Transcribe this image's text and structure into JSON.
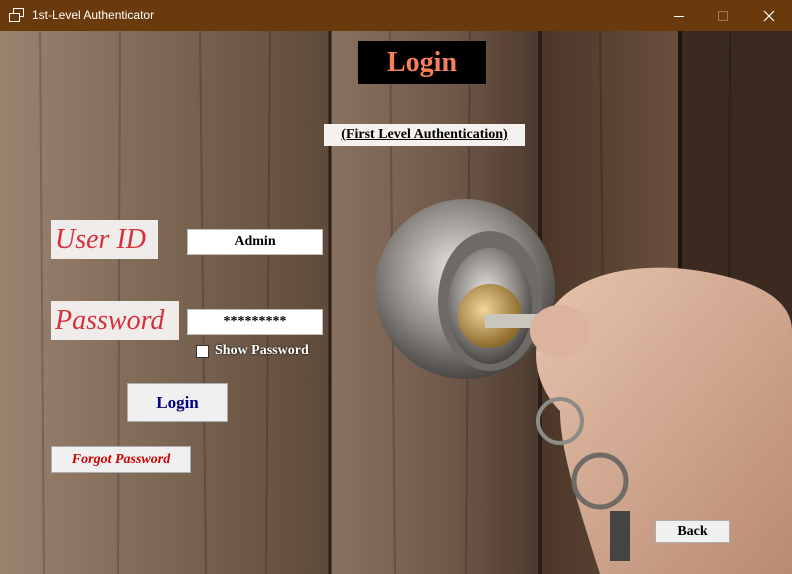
{
  "window": {
    "title": "1st-Level Authenticator",
    "controls": {
      "minimize": "—",
      "maximize": "☐",
      "close": "✕"
    }
  },
  "form": {
    "heading": "Login",
    "subheading": "(First Level Authentication)",
    "user_id_label": "User ID",
    "user_id_value": "Admin",
    "password_label": "Password",
    "password_value": "*********",
    "show_password_label": "Show Password",
    "show_password_checked": false,
    "login_button": "Login",
    "forgot_password_button": "Forgot Password",
    "back_button": "Back"
  },
  "colors": {
    "titlebar": "#6b3a0c",
    "heading_text": "#f5805a",
    "label_text": "#d5303d",
    "login_text": "#000080",
    "forgot_text": "#cc0000"
  },
  "background": {
    "image_icon": "door-lock-key-photo"
  }
}
